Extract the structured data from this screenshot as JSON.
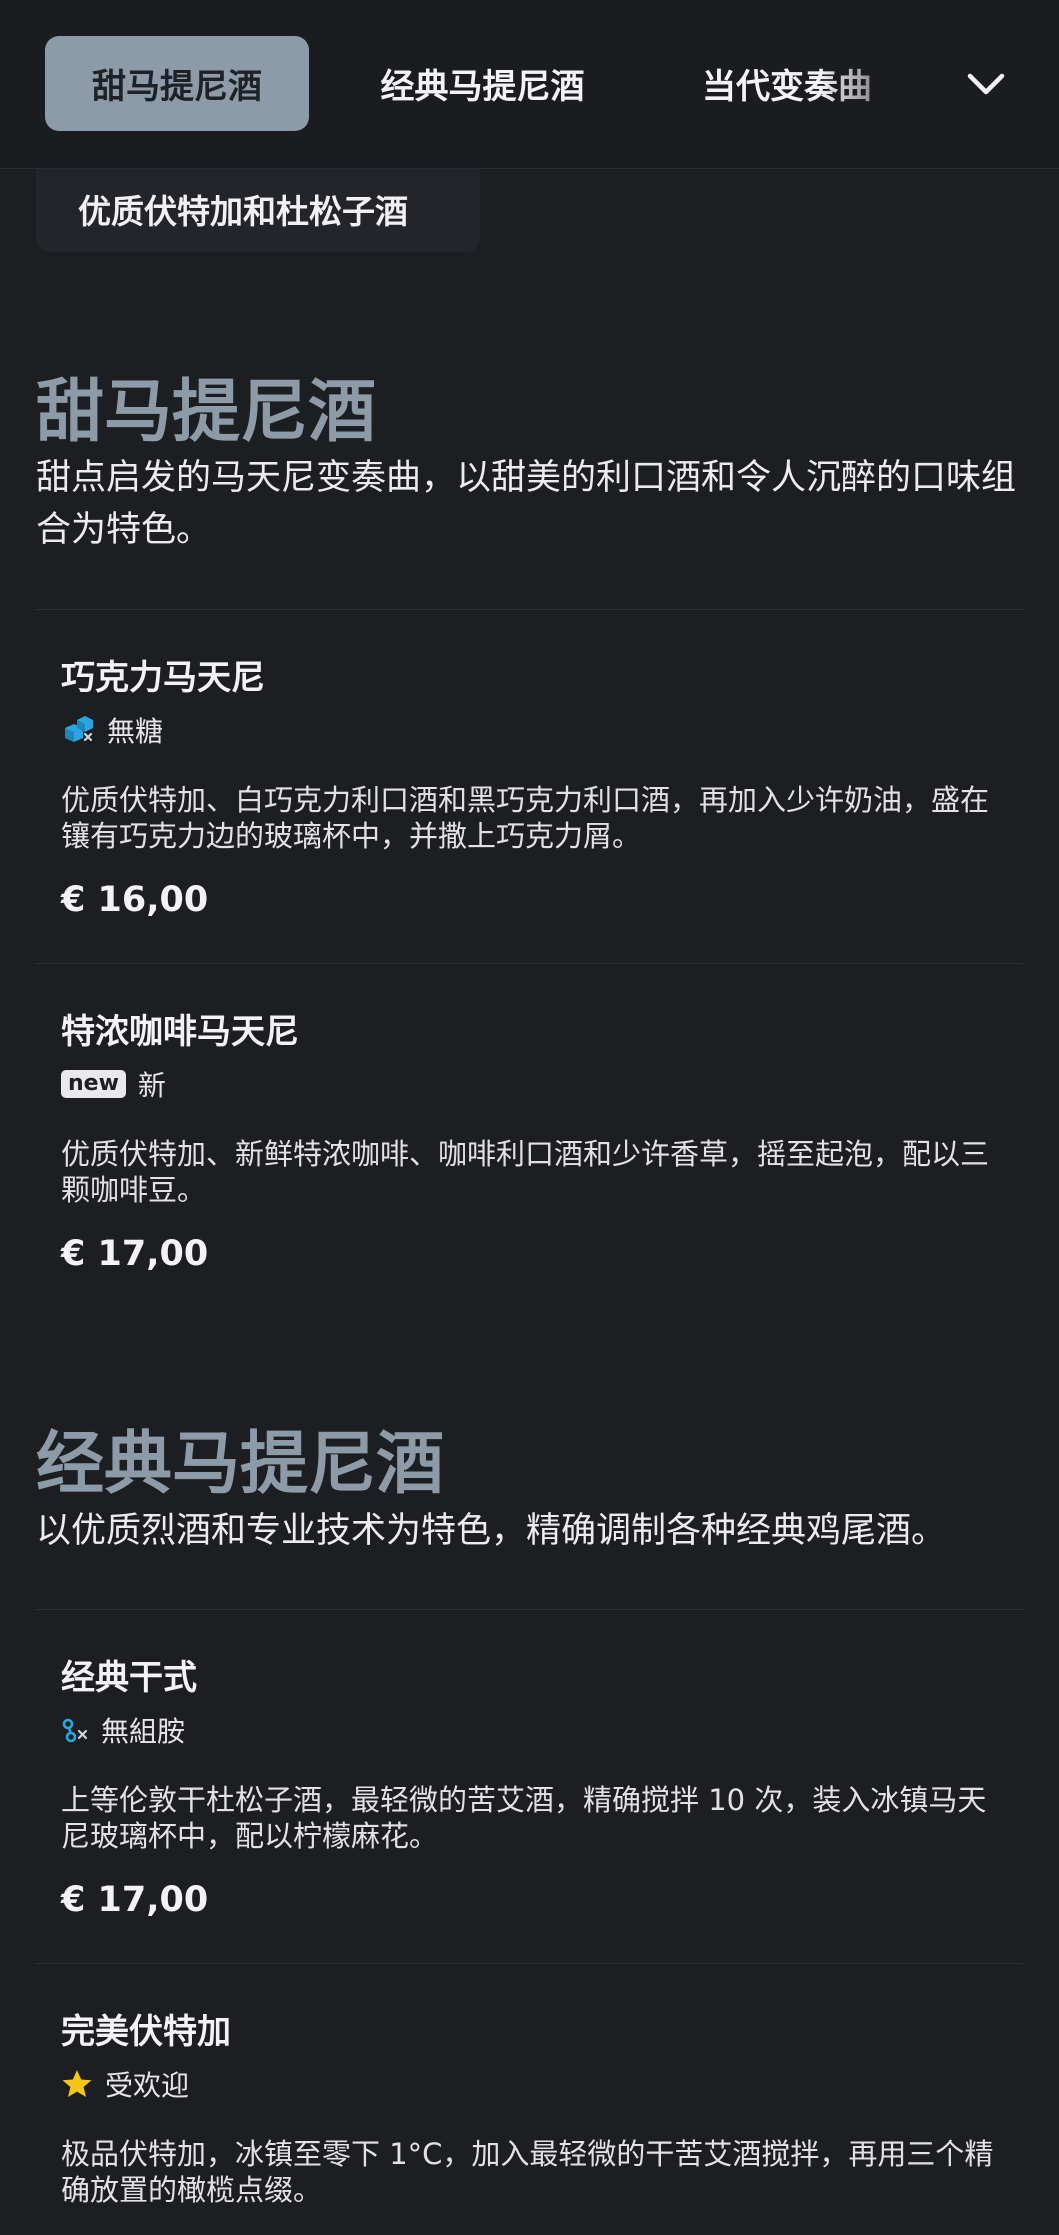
{
  "nav": {
    "tabs": [
      {
        "label": "甜马提尼酒",
        "active": true
      },
      {
        "label": "经典马提尼酒",
        "active": false
      },
      {
        "label": "当代变奏曲",
        "active": false
      }
    ],
    "more_icon": "chevron-down-icon"
  },
  "previous_chip": {
    "label": "优质伏特加和杜松子酒"
  },
  "sections": [
    {
      "title": "甜马提尼酒",
      "description": "甜点启发的马天尼变奏曲，以甜美的利口酒和令人沉醉的口味组合为特色。",
      "items": [
        {
          "name": "巧克力马天尼",
          "tag_icon": "sugar-cubes-icon",
          "tag": "無糖",
          "description": "优质伏特加、白巧克力利口酒和黑巧克力利口酒，再加入少许奶油，盛在镶有巧克力边的玻璃杯中，并撒上巧克力屑。",
          "price": "€ 16,00"
        },
        {
          "name": "特浓咖啡马天尼",
          "tag_badge": "new",
          "tag": "新",
          "description": "优质伏特加、新鲜特浓咖啡、咖啡利口酒和少许香草，摇至起泡，配以三颗咖啡豆。",
          "price": "€ 17,00"
        }
      ]
    },
    {
      "title": "经典马提尼酒",
      "description": "以优质烈酒和专业技术为特色，精确调制各种经典鸡尾酒。",
      "items": [
        {
          "name": "经典干式",
          "tag_icon": "histamine-free-icon",
          "tag": "無組胺",
          "description": "上等伦敦干杜松子酒，最轻微的苦艾酒，精确搅拌 10 次，装入冰镇马天尼玻璃杯中，配以柠檬麻花。",
          "price": "€ 17,00"
        },
        {
          "name": "完美伏特加",
          "tag_icon": "star-icon",
          "tag": "受欢迎",
          "description": "极品伏特加，冰镇至零下 1°C，加入最轻微的干苦艾酒搅拌，再用三个精确放置的橄榄点缀。"
        }
      ]
    }
  ],
  "colors": {
    "background": "#1d1e22",
    "accent": "#8c9ba7",
    "icon_blue": "#2aa7e0",
    "star": "#f5c518"
  }
}
